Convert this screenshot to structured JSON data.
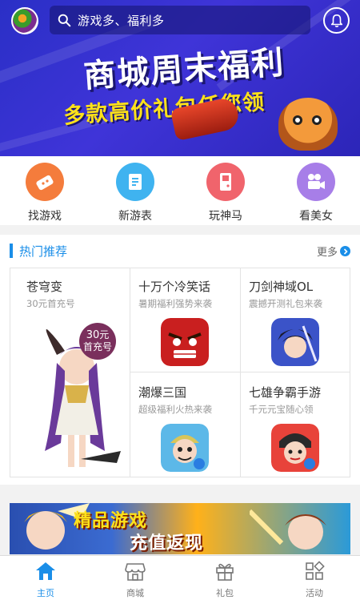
{
  "header": {
    "search_placeholder": "游戏多、福利多",
    "icons": {
      "avatar": "user-avatar",
      "search": "search-icon",
      "notify": "bell-icon"
    }
  },
  "banner": {
    "title": "商城周末福利",
    "subtitle": "多款高价礼包任您领"
  },
  "categories": [
    {
      "label": "找游戏",
      "icon": "gamepad-icon",
      "color": "#f47c3c"
    },
    {
      "label": "新游表",
      "icon": "list-icon",
      "color": "#3fb3f0"
    },
    {
      "label": "玩神马",
      "icon": "gameboy-icon",
      "color": "#f0646c"
    },
    {
      "label": "看美女",
      "icon": "video-camera-icon",
      "color": "#a77ee8"
    }
  ],
  "hot": {
    "title": "热门推荐",
    "more": "更多",
    "featured": {
      "name": "苍穹变",
      "desc": "30元首充号",
      "badge_amount": "30",
      "badge_unit": "元",
      "badge_text": "首充号"
    },
    "games": [
      {
        "name": "十万个冷笑话",
        "desc": "暑期福利强势来袭"
      },
      {
        "name": "刀剑神域OL",
        "desc": "震撼开测礼包来袭"
      },
      {
        "name": "潮爆三国",
        "desc": "超级福利火热来袭"
      },
      {
        "name": "七雄争霸手游",
        "desc": "千元元宝随心领"
      }
    ]
  },
  "promo2": {
    "line1": "精品游戏",
    "line2": "充值返现"
  },
  "tabs": [
    {
      "label": "主页",
      "icon": "home-icon",
      "active": true
    },
    {
      "label": "商城",
      "icon": "store-icon",
      "active": false
    },
    {
      "label": "礼包",
      "icon": "gift-icon",
      "active": false
    },
    {
      "label": "活动",
      "icon": "activity-grid-icon",
      "active": false
    }
  ],
  "colors": {
    "accent": "#1a8ee8",
    "banner": "#3a31d2"
  }
}
